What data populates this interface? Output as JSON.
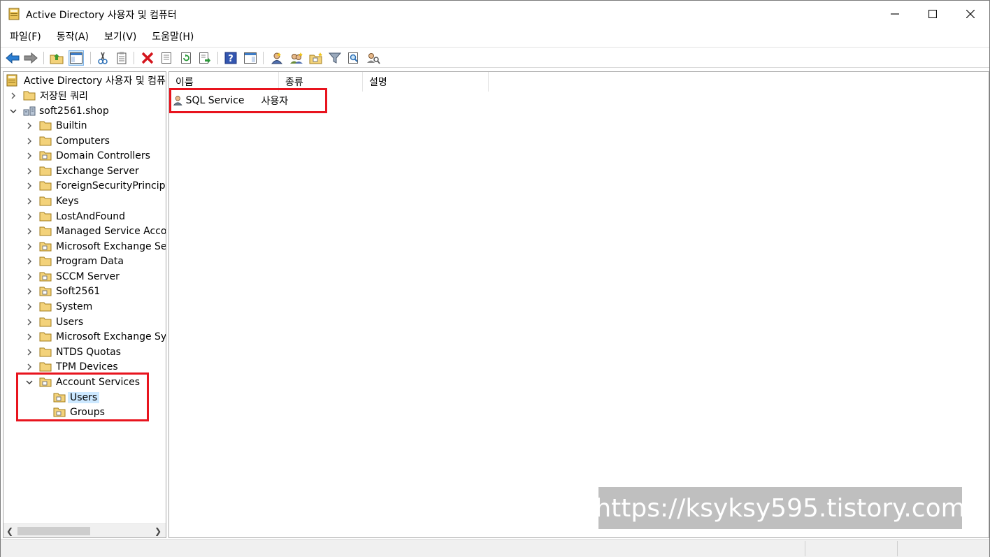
{
  "window": {
    "title": "Active Directory 사용자 및 컴퓨터"
  },
  "menu": [
    "파일(F)",
    "동작(A)",
    "보기(V)",
    "도움말(H)"
  ],
  "toolbar_icons": [
    "back-arrow-icon",
    "forward-arrow-icon",
    "up-folder-icon",
    "show-console-tree-icon",
    "cut-icon",
    "copy-icon",
    "delete-icon",
    "properties-icon",
    "refresh-icon",
    "export-list-icon",
    "help-icon",
    "show-action-pane-icon",
    "new-user-icon",
    "new-group-icon",
    "new-ou-icon",
    "filter-icon",
    "find-icon",
    "delegate-control-icon"
  ],
  "tree": {
    "root": "Active Directory 사용자 및 컴퓨터",
    "saved_queries": "저장된 쿼리",
    "domain": "soft2561.shop",
    "containers": [
      "Builtin",
      "Computers",
      "Domain Controllers",
      "Exchange Server",
      "ForeignSecurityPrincipals",
      "Keys",
      "LostAndFound",
      "Managed Service Accounts",
      "Microsoft Exchange Security Groups",
      "Program Data",
      "SCCM Server",
      "Soft2561",
      "System",
      "Users",
      "Microsoft Exchange System Objects",
      "NTDS Quotas",
      "TPM Devices"
    ],
    "account_services": "Account Services",
    "account_children": [
      "Users",
      "Groups"
    ]
  },
  "list": {
    "columns": [
      "이름",
      "종류",
      "설명"
    ],
    "rows": [
      {
        "name": "SQL Service",
        "type": "사용자",
        "description": ""
      }
    ]
  },
  "watermark": "https://ksyksy595.tistory.com",
  "colors": {
    "highlight": "#e8141e",
    "selection": "#cce8ff",
    "folder": "#f3d27a"
  }
}
